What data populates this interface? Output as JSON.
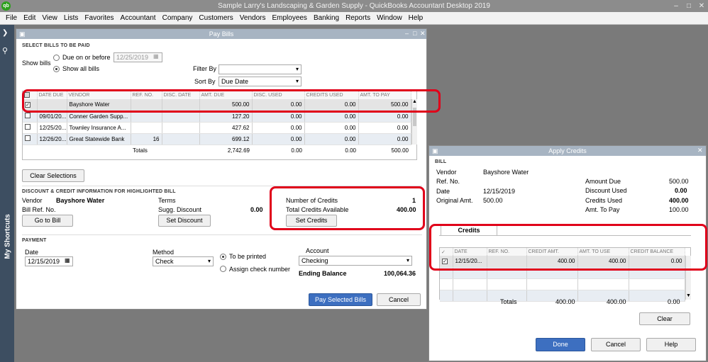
{
  "app": {
    "title": "Sample Larry's Landscaping & Garden Supply  -  QuickBooks Accountant Desktop 2019",
    "logo": "qb"
  },
  "menu": [
    "File",
    "Edit",
    "View",
    "Lists",
    "Favorites",
    "Accountant",
    "Company",
    "Customers",
    "Vendors",
    "Employees",
    "Banking",
    "Reports",
    "Window",
    "Help"
  ],
  "sidebar": {
    "label": "My Shortcuts"
  },
  "paybills": {
    "title": "Pay Bills",
    "section_select": "SELECT BILLS TO BE PAID",
    "show_bills": "Show bills",
    "due_on_before": "Due on or before",
    "due_date": "12/25/2019",
    "show_all": "Show all bills",
    "filter_by": "Filter By",
    "filter_value": "",
    "sort_by": "Sort By",
    "sort_value": "Due Date",
    "columns": [
      "DATE DUE",
      "VENDOR",
      "REF. NO.",
      "DISC. DATE",
      "AMT. DUE",
      "DISC. USED",
      "CREDITS USED",
      "AMT. TO PAY"
    ],
    "rows": [
      {
        "checked": "✓",
        "date": "",
        "vendor": "Bayshore Water",
        "ref": "",
        "disc_date": "",
        "amt_due": "500.00",
        "disc_used": "0.00",
        "credits_used": "0.00",
        "amt_to_pay": "500.00"
      },
      {
        "checked": "",
        "date": "09/01/20...",
        "vendor": "Conner Garden Supp...",
        "ref": "",
        "disc_date": "",
        "amt_due": "127.20",
        "disc_used": "0.00",
        "credits_used": "0.00",
        "amt_to_pay": "0.00"
      },
      {
        "checked": "",
        "date": "12/25/20...",
        "vendor": "Townley Insurance A...",
        "ref": "",
        "disc_date": "",
        "amt_due": "427.62",
        "disc_used": "0.00",
        "credits_used": "0.00",
        "amt_to_pay": "0.00"
      },
      {
        "checked": "",
        "date": "12/26/20...",
        "vendor": "Great Statewide Bank",
        "ref": "16",
        "disc_date": "",
        "amt_due": "699.12",
        "disc_used": "0.00",
        "credits_used": "0.00",
        "amt_to_pay": "0.00"
      }
    ],
    "totals": {
      "label": "Totals",
      "amt_due": "2,742.69",
      "disc_used": "0.00",
      "credits_used": "0.00",
      "amt_to_pay": "500.00"
    },
    "clear_selections": "Clear Selections",
    "section_discount": "DISCOUNT & CREDIT INFORMATION FOR HIGHLIGHTED BILL",
    "vendor_label": "Vendor",
    "vendor_value": "Bayshore Water",
    "bill_ref_label": "Bill Ref. No.",
    "terms_label": "Terms",
    "sugg_discount_label": "Sugg. Discount",
    "sugg_discount_value": "0.00",
    "num_credits_label": "Number of Credits",
    "num_credits_value": "1",
    "total_credits_label": "Total Credits Available",
    "total_credits_value": "400.00",
    "go_to_bill": "Go to Bill",
    "set_discount": "Set Discount",
    "set_credits": "Set Credits",
    "section_payment": "PAYMENT",
    "date_label": "Date",
    "date_value": "12/15/2019",
    "method_label": "Method",
    "method_value": "Check",
    "to_be_printed": "To be printed",
    "assign_check": "Assign check number",
    "account_label": "Account",
    "account_value": "Checking",
    "ending_balance_label": "Ending Balance",
    "ending_balance_value": "100,064.36",
    "pay_selected": "Pay Selected Bills",
    "cancel": "Cancel"
  },
  "credits": {
    "title": "Apply Credits",
    "section_bill": "BILL",
    "vendor_label": "Vendor",
    "vendor_value": "Bayshore Water",
    "ref_label": "Ref. No.",
    "date_label": "Date",
    "date_value": "12/15/2019",
    "orig_amt_label": "Original Amt.",
    "orig_amt_value": "500.00",
    "amount_due_label": "Amount Due",
    "amount_due_value": "500.00",
    "discount_used_label": "Discount Used",
    "discount_used_value": "0.00",
    "credits_used_label": "Credits Used",
    "credits_used_value": "400.00",
    "amt_to_pay_label": "Amt. To Pay",
    "amt_to_pay_value": "100.00",
    "tab": "Credits",
    "columns": [
      "✓",
      "DATE",
      "REF. NO.",
      "CREDIT AMT.",
      "AMT. TO USE",
      "CREDIT BALANCE"
    ],
    "row": {
      "checked": "✓",
      "date": "12/15/20...",
      "ref": "",
      "credit_amt": "400.00",
      "amt_to_use": "400.00",
      "credit_balance": "0.00"
    },
    "totals": {
      "label": "Totals",
      "credit_amt": "400.00",
      "amt_to_use": "400.00",
      "credit_balance": "0.00"
    },
    "clear": "Clear",
    "done": "Done",
    "cancel": "Cancel",
    "help": "Help"
  },
  "colors": {
    "highlight": "#e0001a",
    "primary_button": "#3d6fc0",
    "sidebar": "#3d4e61"
  }
}
